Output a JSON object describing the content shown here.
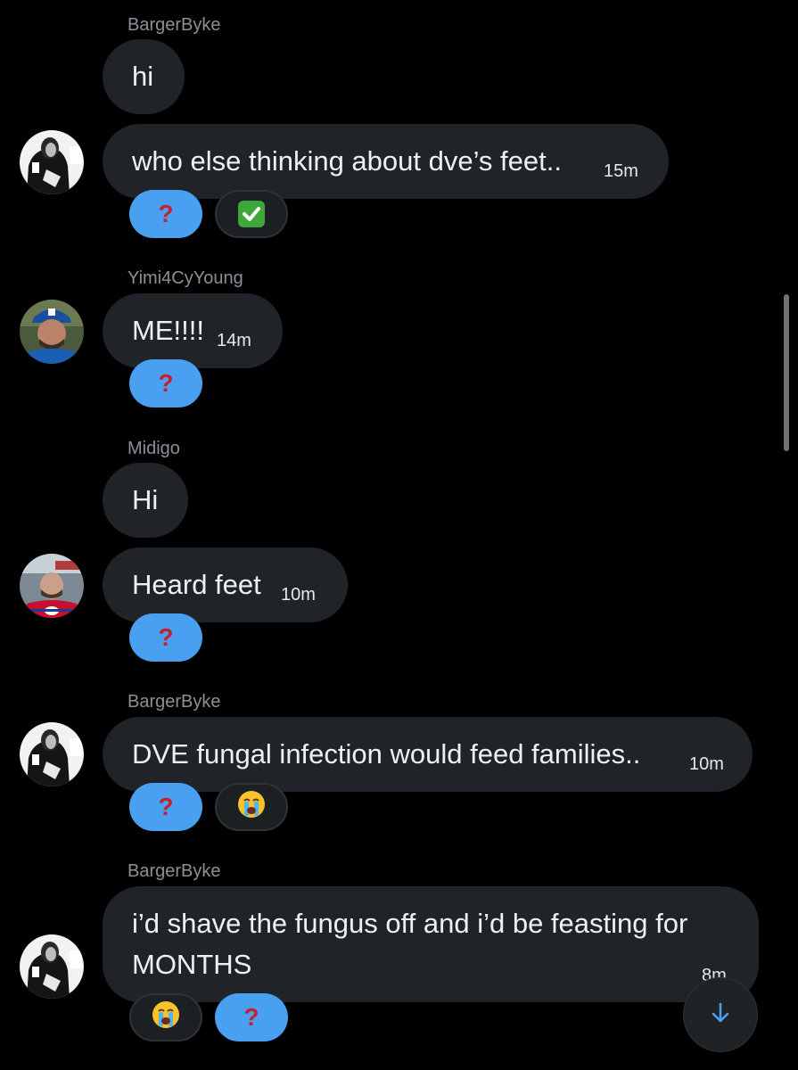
{
  "messages": [
    {
      "sender": "BargerByke",
      "text": "hi"
    },
    {
      "text": "who else thinking about dve’s feet..",
      "time": "15m",
      "reactions": [
        {
          "emoji": "?",
          "icon": "red-question-mark-icon"
        },
        {
          "emoji": "✅",
          "icon": "check-mark-button-icon"
        }
      ]
    },
    {
      "sender": "Yimi4CyYoung",
      "text": "ME!!!!",
      "time": "14m",
      "reactions": [
        {
          "emoji": "?",
          "icon": "red-question-mark-icon"
        }
      ]
    },
    {
      "sender": "Midigo",
      "text": "Hi"
    },
    {
      "text": "Heard feet",
      "time": "10m",
      "reactions": [
        {
          "emoji": "?",
          "icon": "red-question-mark-icon"
        }
      ]
    },
    {
      "sender": "BargerByke",
      "text": "DVE fungal infection would feed families..",
      "time": "10m",
      "reactions": [
        {
          "emoji": "?",
          "icon": "red-question-mark-icon"
        },
        {
          "emoji": "😭",
          "icon": "loudly-crying-face-icon"
        }
      ]
    },
    {
      "sender": "BargerByke",
      "text_line1": "i’d shave the fungus off and i’d be feasting for",
      "text_line2": "MONTHS",
      "time": "8m",
      "reactions": [
        {
          "emoji": "😭",
          "icon": "loudly-crying-face-icon"
        },
        {
          "emoji": "?",
          "icon": "red-question-mark-icon"
        }
      ]
    }
  ],
  "colors": {
    "background": "#000000",
    "bubble": "#202327",
    "sender_name": "#8b9096",
    "reaction_selected": "#4aa0f0",
    "question_mark": "#c4222a",
    "scroll_arrow": "#4aa0f0"
  },
  "controls": {
    "scroll_down_icon": "arrow-down-icon"
  }
}
